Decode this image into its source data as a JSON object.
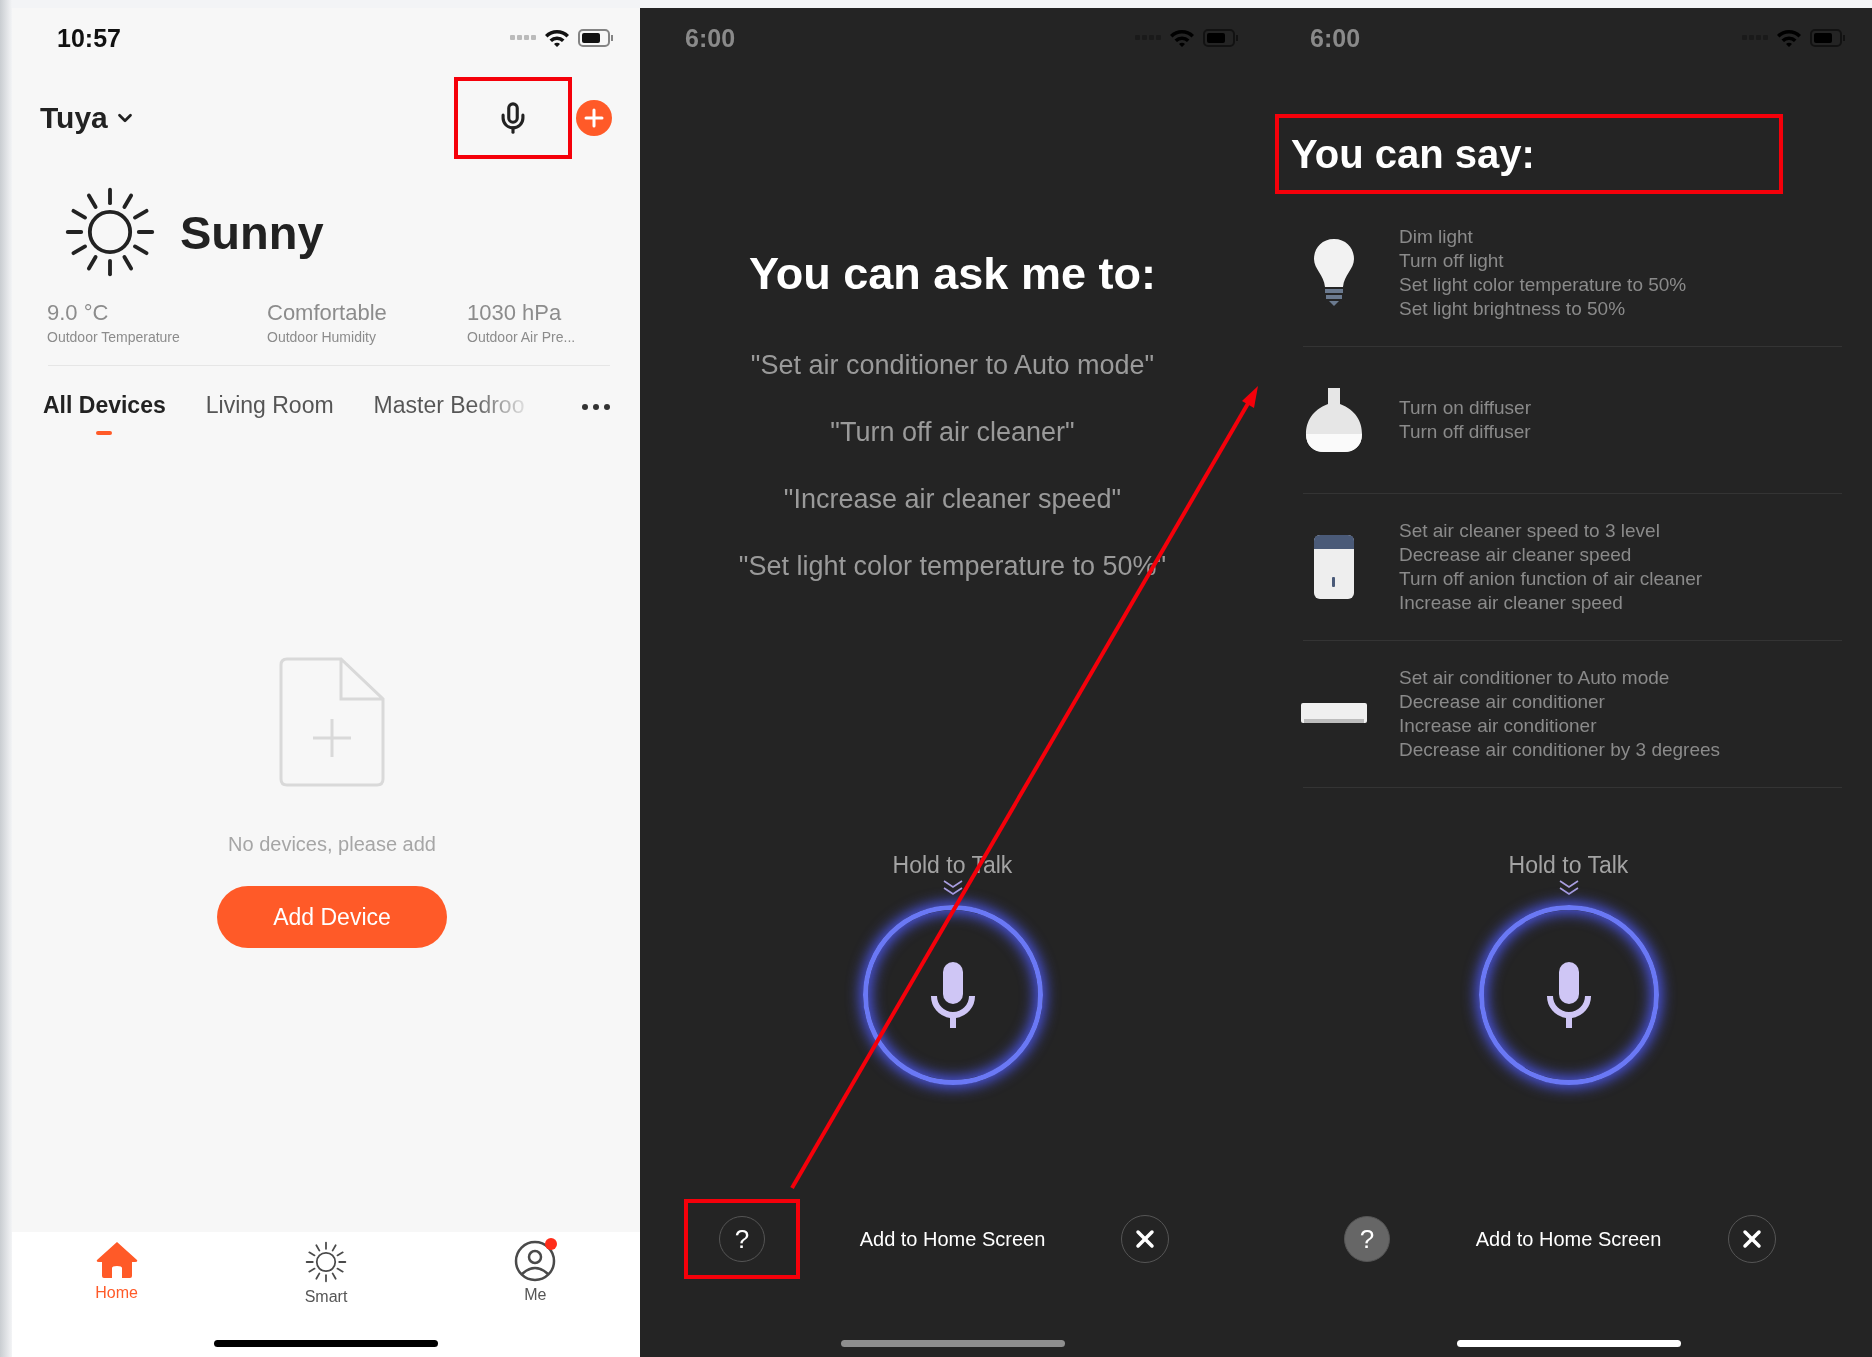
{
  "left_screen": {
    "status_bar": {
      "time": "10:57"
    },
    "home_name": "Tuya",
    "mic_button": {
      "highlighted": true
    },
    "weather": {
      "condition": "Sunny",
      "stats": [
        {
          "value": "9.0 °C",
          "label": "Outdoor Temperature"
        },
        {
          "value": "Comfortable",
          "label": "Outdoor Humidity"
        },
        {
          "value": "1030 hPa",
          "label": "Outdoor Air Pre..."
        }
      ]
    },
    "room_tabs": [
      {
        "label": "All Devices",
        "selected": true
      },
      {
        "label": "Living Room",
        "selected": false
      },
      {
        "label": "Master Bedroo",
        "selected": false
      }
    ],
    "empty_state": {
      "message": "No devices, please add",
      "button": "Add Device"
    },
    "tab_bar": [
      {
        "kind": "home",
        "label": "Home",
        "selected": true,
        "badge": false
      },
      {
        "kind": "smart",
        "label": "Smart",
        "selected": false,
        "badge": false
      },
      {
        "kind": "me",
        "label": "Me",
        "selected": false,
        "badge": true
      }
    ]
  },
  "middle_screen": {
    "status_bar": {
      "time": "6:00"
    },
    "title": "You can ask me to:",
    "examples": [
      "\"Set air conditioner to Auto mode\"",
      "\"Turn off air cleaner\"",
      "\"Increase air cleaner speed\"",
      "\"Set light color temperature to 50%\""
    ],
    "hold_label": "Hold to Talk",
    "help_button": {
      "label": "?",
      "highlighted": true,
      "pressed": false
    },
    "add_to_home": "Add to Home Screen"
  },
  "right_screen": {
    "status_bar": {
      "time": "6:00"
    },
    "title": {
      "text": "You can say:",
      "highlighted": true
    },
    "commands": [
      {
        "kind": "bulb",
        "lines": [
          "Dim light",
          "Turn off light",
          "Set light color temperature to 50%",
          "Set light brightness to 50%"
        ]
      },
      {
        "kind": "diffuser",
        "lines": [
          "Turn on diffuser",
          "Turn off diffuser"
        ]
      },
      {
        "kind": "air_cleaner",
        "lines": [
          "Set air cleaner speed to 3 level",
          "Decrease air cleaner speed",
          "Turn off anion function of air cleaner",
          "Increase air cleaner speed"
        ]
      },
      {
        "kind": "air_conditioner",
        "lines": [
          "Set air conditioner to Auto mode",
          "Decrease air conditioner",
          "Increase air conditioner",
          "Decrease air conditioner by 3 degrees"
        ]
      }
    ],
    "hold_label": "Hold to Talk",
    "help_button": {
      "label": "?",
      "highlighted": false,
      "pressed": true
    },
    "add_to_home": "Add to Home Screen"
  },
  "annotation_arrow": true
}
